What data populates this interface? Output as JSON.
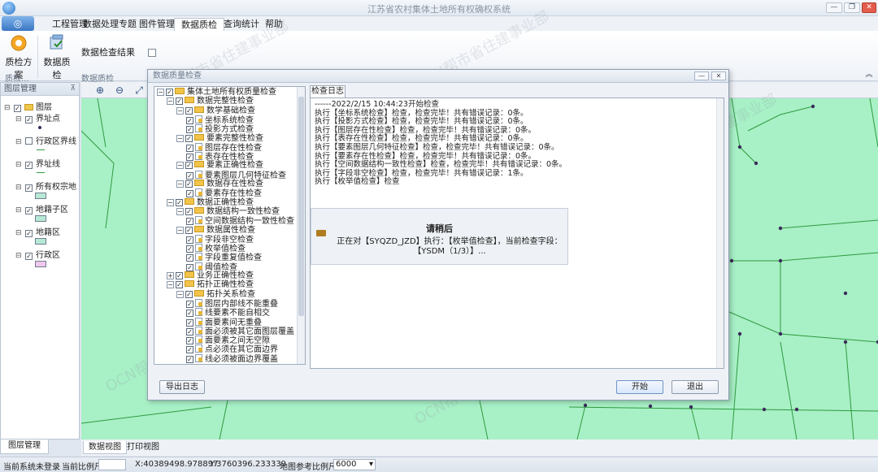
{
  "window": {
    "title": "江苏省农村集体土地所有权确权系统",
    "controls": [
      "▲",
      "—",
      "❐",
      "✕"
    ]
  },
  "menu": {
    "orb_glyph": "◎",
    "tabs": [
      {
        "label": "工程管理"
      },
      {
        "label": "数据处理专题"
      },
      {
        "label": "图件管理"
      },
      {
        "label": "数据质检",
        "active": true
      },
      {
        "label": "查询统计"
      },
      {
        "label": "帮助"
      }
    ],
    "collapse_glyph": "︽"
  },
  "ribbon": {
    "btn_scheme": "质检方案",
    "btn_check": "数据质检",
    "btn_result": "数据检查结果",
    "group_1": "质检...",
    "group_2": "数据质检"
  },
  "layer_panel": {
    "title": "图层管理",
    "pin": "⊼",
    "root": "图层",
    "layers": [
      {
        "label": "界址点",
        "checked": true,
        "legend": "point"
      },
      {
        "label": "行政区界线",
        "checked": false,
        "legend": "line"
      },
      {
        "label": "界址线",
        "checked": true,
        "legend": "line"
      },
      {
        "label": "所有权宗地",
        "checked": true,
        "legend": "fill-teal"
      },
      {
        "label": "地籍子区",
        "checked": true,
        "legend": "fill-teal"
      },
      {
        "label": "地籍区",
        "checked": true,
        "legend": "fill-teal"
      },
      {
        "label": "行政区",
        "checked": true,
        "legend": "fill-pink"
      }
    ],
    "bottom_tab": "图层管理"
  },
  "map": {
    "toolbar": [
      "⊕",
      "⊖",
      "⤢"
    ],
    "bottom_tabs": [
      "数据视图",
      "打印视图"
    ],
    "colors": {
      "bg": "#a8f0c6",
      "line": "#2e9b3f",
      "node": "#3b2b5c"
    }
  },
  "status": {
    "login": "当前系统未登录",
    "scale_label": "当前比例尺",
    "scale_value": "",
    "x": "X:40389498.978897",
    "y": "Y:3760396.233339",
    "ref_scale_label": "地图参考比例尺:",
    "ref_scale_value": "6000"
  },
  "dialog": {
    "title": "数据质量检查",
    "tree": [
      {
        "level": 0,
        "label": "集体土地所有权质量检查",
        "toggle": "⊟"
      },
      {
        "level": 1,
        "label": "数据完整性检查",
        "toggle": "⊟"
      },
      {
        "level": 2,
        "label": "数学基础检查",
        "toggle": "⊟"
      },
      {
        "level": 3,
        "label": "坐标系统检查"
      },
      {
        "level": 3,
        "label": "投影方式检查"
      },
      {
        "level": 2,
        "label": "要素完整性检查",
        "toggle": "⊟"
      },
      {
        "level": 3,
        "label": "图层存在性检查"
      },
      {
        "level": 3,
        "label": "表存在性检查"
      },
      {
        "level": 2,
        "label": "要素正确性检查",
        "toggle": "⊟"
      },
      {
        "level": 3,
        "label": "要素图层几何特征检查"
      },
      {
        "level": 2,
        "label": "数据存在性检查",
        "toggle": "⊟"
      },
      {
        "level": 3,
        "label": "要素存在性检查"
      },
      {
        "level": 1,
        "label": "数据正确性检查",
        "toggle": "⊟"
      },
      {
        "level": 2,
        "label": "数据结构一致性检查",
        "toggle": "⊟"
      },
      {
        "level": 3,
        "label": "空间数据结构一致性检查"
      },
      {
        "level": 2,
        "label": "数据属性检查",
        "toggle": "⊟"
      },
      {
        "level": 3,
        "label": "字段非空检查"
      },
      {
        "level": 3,
        "label": "枚举值检查"
      },
      {
        "level": 3,
        "label": "字段重复值检查"
      },
      {
        "level": 3,
        "label": "阈值检查"
      },
      {
        "level": 1,
        "label": "业务正确性检查",
        "toggle": "⊞"
      },
      {
        "level": 1,
        "label": "拓扑正确性检查",
        "toggle": "⊟"
      },
      {
        "level": 2,
        "label": "拓扑关系检查",
        "toggle": "⊟"
      },
      {
        "level": 3,
        "label": "图层内部线不能重叠"
      },
      {
        "level": 3,
        "label": "线要素不能自相交"
      },
      {
        "level": 3,
        "label": "面要素间无重叠"
      },
      {
        "level": 3,
        "label": "面必须被其它面图层覆盖"
      },
      {
        "level": 3,
        "label": "面要素之间无空隙"
      },
      {
        "level": 3,
        "label": "点必须在其它面边界"
      },
      {
        "level": 3,
        "label": "线必须被面边界覆盖"
      }
    ],
    "log_tab": "检查日志",
    "log_lines": [
      "------2022/2/15 10:44:23开始检查",
      "执行【坐标系统检查】检查，检查完毕！共有错误记录：0条。",
      "执行【投影方式检查】检查，检查完毕！共有错误记录：0条。",
      "执行【图层存在性检查】检查，检查完毕！共有错误记录：0条。",
      "执行【表存在性检查】检查，检查完毕！共有错误记录：0条。",
      "执行【要素图层几何特征检查】检查，检查完毕！共有错误记录：0条。",
      "执行【要素存在性检查】检查，检查完毕！共有错误记录：0条。",
      "执行【空间数据结构一致性检查】检查，检查完毕！共有错误记录：0条。",
      "执行【字段非空检查】检查，检查完毕！共有错误记录：1条。",
      "执行【枚举值检查】检查"
    ],
    "wait_title": "请稍后",
    "wait_line1": "正在对【SYQZD_JZD】执行：【枚举值检查】，当前检查字段：",
    "wait_line2": "【YSDM（1/3）】...",
    "btn_export": "导出日志",
    "btn_start": "开始",
    "btn_exit": "退出"
  }
}
